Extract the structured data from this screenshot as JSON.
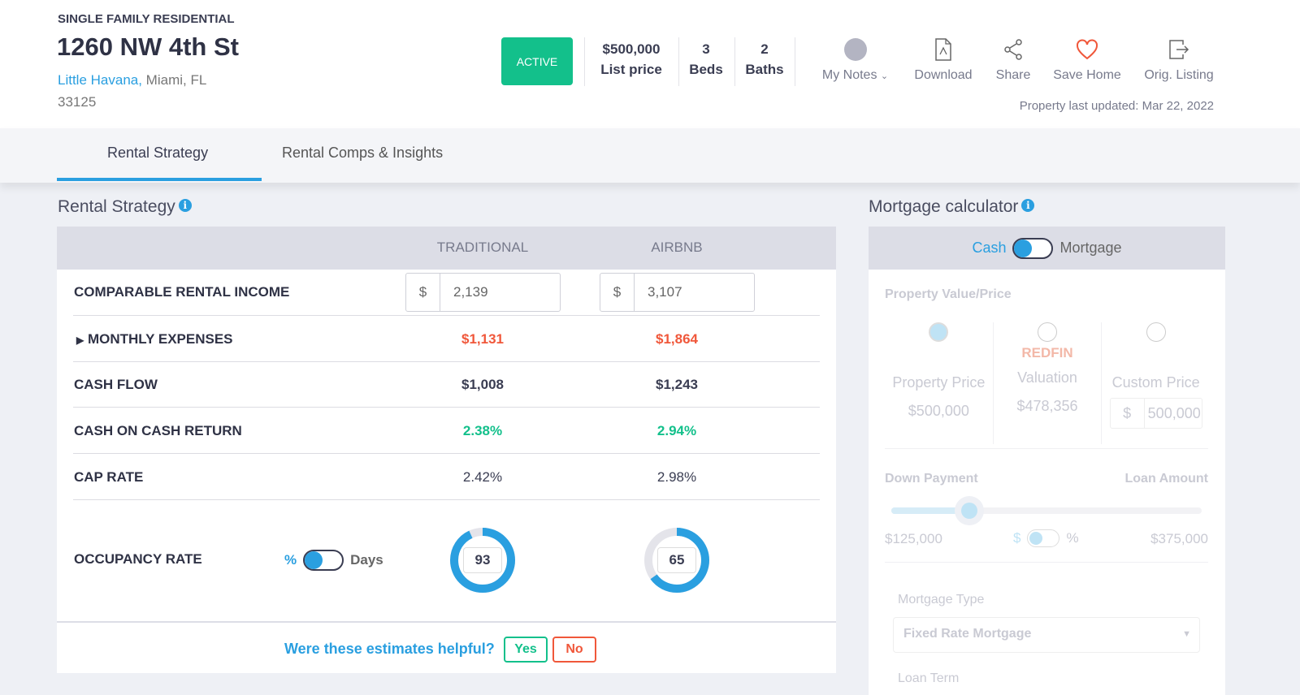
{
  "property": {
    "type": "SINGLE FAMILY RESIDENTIAL",
    "address": "1260 NW 4th St",
    "neighborhood": "Little Havana,",
    "city_state": " Miami, FL",
    "zip": "33125",
    "status": "ACTIVE",
    "price": "$500,000",
    "price_label": "List price",
    "beds": "3",
    "beds_label": "Beds",
    "baths": "2",
    "baths_label": "Baths",
    "last_updated": "Property last updated: Mar 22, 2022"
  },
  "actions": [
    {
      "label": "My Notes",
      "icon": "avatar"
    },
    {
      "label": "Download",
      "icon": "pdf-icon"
    },
    {
      "label": "Share",
      "icon": "share-icon"
    },
    {
      "label": "Save Home",
      "icon": "heart-icon"
    },
    {
      "label": "Orig. Listing",
      "icon": "external-icon"
    }
  ],
  "tabs": [
    {
      "label": "Rental Strategy",
      "active": true
    },
    {
      "label": "Rental Comps & Insights",
      "active": false
    }
  ],
  "rental": {
    "title": "Rental Strategy",
    "columns": [
      "TRADITIONAL",
      "AIRBNB"
    ],
    "income_label": "COMPARABLE RENTAL INCOME",
    "currency": "$",
    "income": [
      "2,139",
      "3,107"
    ],
    "expenses_label": "MONTHLY EXPENSES",
    "expenses": [
      "$1,131",
      "$1,864"
    ],
    "cashflow_label": "CASH FLOW",
    "cashflow": [
      "$1,008",
      "$1,243"
    ],
    "coc_label": "CASH ON CASH RETURN",
    "coc": [
      "2.38%",
      "2.94%"
    ],
    "cap_label": "CAP RATE",
    "cap": [
      "2.42%",
      "2.98%"
    ],
    "occupancy_label": "OCCUPANCY RATE",
    "occ_pct": "%",
    "occ_days": "Days",
    "occupancy": [
      "93",
      "65"
    ],
    "feedback": "Were these estimates helpful?",
    "yes": "Yes",
    "no": "No"
  },
  "mortgage": {
    "title": "Mortgage calculator",
    "cash": "Cash",
    "mortgage": "Mortgage",
    "pv_label": "Property Value/Price",
    "brand": "REDFIN",
    "options": [
      {
        "label": "Property Price",
        "value": "$500,000"
      },
      {
        "label": "Valuation",
        "value": "$478,356"
      },
      {
        "label": "Custom Price",
        "value": "500,000"
      }
    ],
    "down_label": "Down Payment",
    "loan_label": "Loan Amount",
    "down_value": "$125,000",
    "loan_value": "$375,000",
    "down_fraction": 0.25,
    "dollar": "$",
    "percent": "%",
    "type_label": "Mortgage Type",
    "type_value": "Fixed Rate Mortgage",
    "term_label": "Loan Term"
  },
  "colors": {
    "accent": "#2a9fe0",
    "active": "#13c08b",
    "negative": "#f0573a",
    "positive": "#13c08b"
  }
}
